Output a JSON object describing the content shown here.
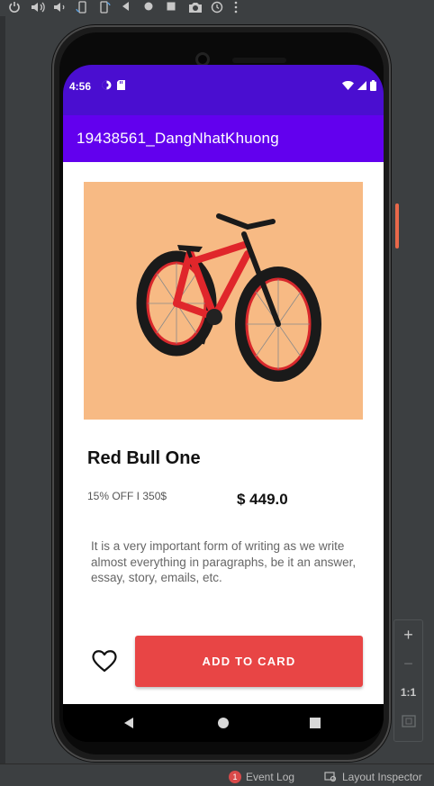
{
  "status_bar": {
    "time": "4:56"
  },
  "app_bar": {
    "title": "19438561_DangNhatKhuong"
  },
  "product": {
    "name": "Red Bull One",
    "discount": "15% OFF I 350$",
    "price": "$ 449.0",
    "description": "It is a very important form of writing as we write almost everything in paragraphs, be it an answer, essay, story, emails, etc.",
    "image_bg": "#f7ba84"
  },
  "actions": {
    "add_to_card": "ADD TO CARD"
  },
  "zoom": {
    "plus": "+",
    "minus": "−",
    "one_to_one": "1:1"
  },
  "ide_bottom": {
    "event_log_count": "1",
    "event_log": "Event Log",
    "layout_inspector": "Layout Inspector"
  },
  "colors": {
    "status_bar": "#4a0ed0",
    "app_bar": "#6200ee",
    "button": "#e84545"
  }
}
